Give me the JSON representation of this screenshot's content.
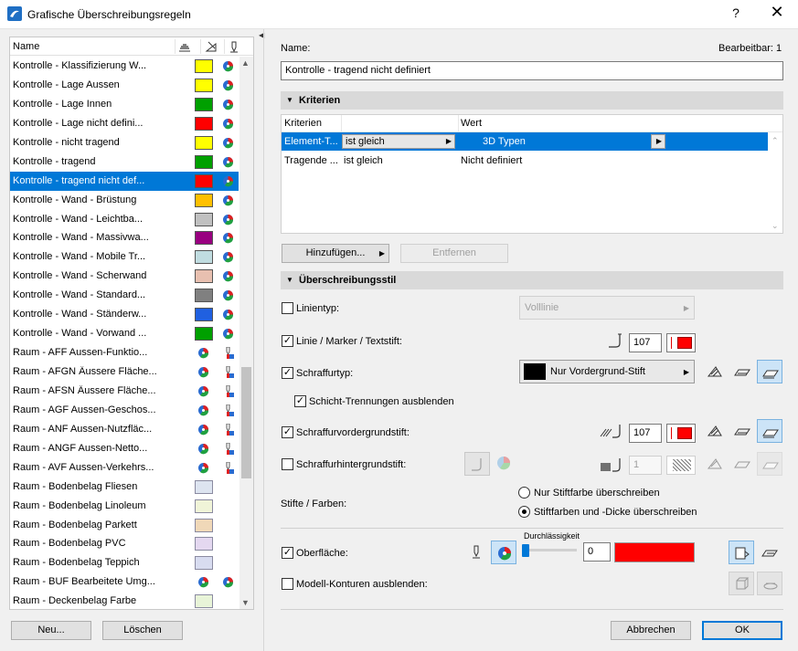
{
  "window": {
    "title": "Grafische Überschreibungsregeln",
    "help": "?",
    "close": "✕"
  },
  "list": {
    "header_name": "Name",
    "rows": [
      {
        "label": "Kontrolle - Klassifizierung W...",
        "color": "#ffff00",
        "kind": "swatch"
      },
      {
        "label": "Kontrolle - Lage Aussen",
        "color": "#ffff00",
        "kind": "swatch"
      },
      {
        "label": "Kontrolle - Lage Innen",
        "color": "#00a000",
        "kind": "swatch"
      },
      {
        "label": "Kontrolle - Lage nicht defini...",
        "color": "#ff0000",
        "kind": "swatch"
      },
      {
        "label": "Kontrolle - nicht tragend",
        "color": "#ffff00",
        "kind": "swatch"
      },
      {
        "label": "Kontrolle - tragend",
        "color": "#00a000",
        "kind": "swatch"
      },
      {
        "label": "Kontrolle - tragend nicht def...",
        "color": "#ff0000",
        "kind": "swatch",
        "selected": true
      },
      {
        "label": "Kontrolle - Wand - Brüstung",
        "color": "#ffc000",
        "kind": "swatch"
      },
      {
        "label": "Kontrolle - Wand - Leichtba...",
        "color": "#c0c0c0",
        "kind": "swatch"
      },
      {
        "label": "Kontrolle - Wand - Massivwa...",
        "color": "#990080",
        "kind": "swatch"
      },
      {
        "label": "Kontrolle - Wand - Mobile Tr...",
        "color": "#c0dce0",
        "kind": "swatch"
      },
      {
        "label": "Kontrolle - Wand - Scherwand",
        "color": "#e8c0b0",
        "kind": "swatch"
      },
      {
        "label": "Kontrolle - Wand - Standard...",
        "color": "#808080",
        "kind": "swatch"
      },
      {
        "label": "Kontrolle - Wand - Ständerw...",
        "color": "#2060e0",
        "kind": "swatch"
      },
      {
        "label": "Kontrolle - Wand - Vorwand ...",
        "color": "#00a000",
        "kind": "swatch"
      },
      {
        "label": "Raum - AFF Aussen-Funktio...",
        "color": "",
        "kind": "icons"
      },
      {
        "label": "Raum - AFGN Äussere Fläche...",
        "color": "",
        "kind": "icons"
      },
      {
        "label": "Raum - AFSN Äussere Fläche...",
        "color": "",
        "kind": "icons"
      },
      {
        "label": "Raum - AGF Aussen-Geschos...",
        "color": "",
        "kind": "icons"
      },
      {
        "label": "Raum - ANF Aussen-Nutzfläc...",
        "color": "",
        "kind": "icons"
      },
      {
        "label": "Raum - ANGF Aussen-Netto...",
        "color": "",
        "kind": "icons"
      },
      {
        "label": "Raum - AVF Aussen-Verkehrs...",
        "color": "",
        "kind": "icons"
      },
      {
        "label": "Raum - Bodenbelag Fliesen",
        "color": "#dde4f0",
        "kind": "swatch-light"
      },
      {
        "label": "Raum - Bodenbelag Linoleum",
        "color": "#f0f4d8",
        "kind": "swatch-light"
      },
      {
        "label": "Raum - Bodenbelag Parkett",
        "color": "#f0d8b8",
        "kind": "swatch-light"
      },
      {
        "label": "Raum - Bodenbelag PVC",
        "color": "#e4d8f0",
        "kind": "swatch-light"
      },
      {
        "label": "Raum - Bodenbelag Teppich",
        "color": "#d8dcf0",
        "kind": "swatch-light"
      },
      {
        "label": "Raum - BUF Bearbeitete Umg...",
        "color": "",
        "kind": "icons2"
      },
      {
        "label": "Raum - Deckenbelag Farbe",
        "color": "#e8f4d8",
        "kind": "swatch-light"
      }
    ]
  },
  "buttons": {
    "new": "Neu...",
    "delete": "Löschen",
    "add": "Hinzufügen...",
    "remove": "Entfernen",
    "cancel": "Abbrechen",
    "ok": "OK"
  },
  "name_label": "Name:",
  "editable_label": "Bearbeitbar: 1",
  "name_value": "Kontrolle - tragend nicht definiert",
  "criteria": {
    "section": "Kriterien",
    "col1": "Kriterien",
    "col2": "Wert",
    "rows": [
      {
        "crit": "Element-T...",
        "op": "ist gleich",
        "value": "3D Typen",
        "selected": true
      },
      {
        "crit": "Tragende ...",
        "op": "ist gleich",
        "value": "Nicht definiert",
        "selected": false
      }
    ]
  },
  "style": {
    "section": "Überschreibungsstil",
    "linetype_label": "Linientyp:",
    "linetype_value": "Volllinie",
    "pen_label": "Linie / Marker / Textstift:",
    "pen_value": "107",
    "hatch_label": "Schraffurtyp:",
    "hatch_value": "Nur Vordergrund-Stift",
    "layer_sep_label": "Schicht-Trennungen ausblenden",
    "fg_pen_label": "Schraffurvordergrundstift:",
    "fg_pen_value": "107",
    "bg_pen_label": "Schraffurhintergrundstift:",
    "bg_pen_value": "1",
    "pens_colors_label": "Stifte / Farben:",
    "radio1": "Nur Stiftfarbe überschreiben",
    "radio2": "Stiftfarben und -Dicke überschreiben",
    "transparency_label": "Durchlässigkeit",
    "surface_label": "Oberfläche:",
    "surface_value": "0",
    "model_contours_label": "Modell-Konturen ausblenden:"
  },
  "colors": {
    "accent": "#0078d7",
    "red": "#ff0000"
  }
}
